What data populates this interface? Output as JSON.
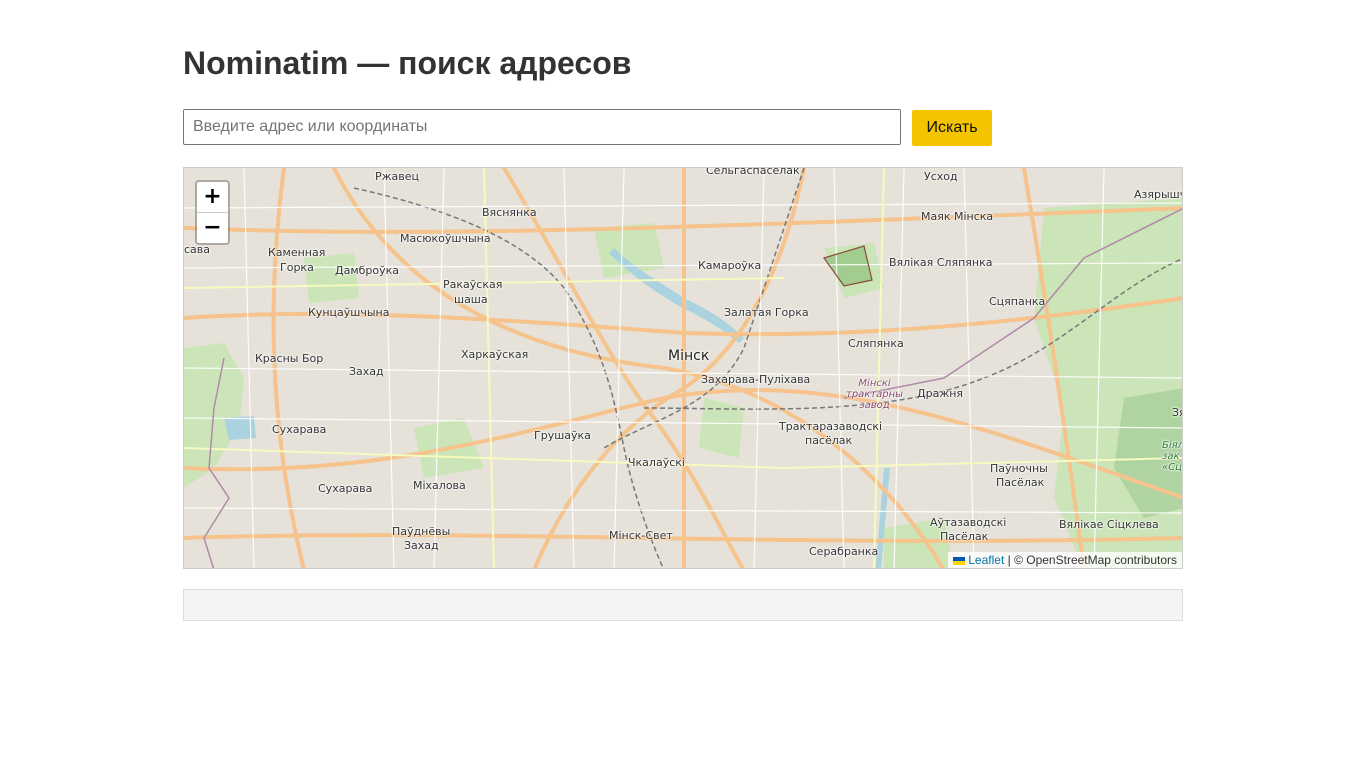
{
  "page": {
    "title": "Nominatim — поиск адресов"
  },
  "search": {
    "placeholder": "Введите адрес или координаты",
    "value": "",
    "button_label": "Искать",
    "button_color": "#f5c400"
  },
  "map": {
    "zoom_in_label": "+",
    "zoom_out_label": "−",
    "attribution": {
      "leaflet_label": "Leaflet",
      "separator": " | © ",
      "osm_label": "OpenStreetMap contributors"
    },
    "labels": {
      "minsk": "Мінск",
      "rzhavets": "Ржавец",
      "vyasnyanka": "Вяснянка",
      "selhaspaselak": "Сельгаспаселак",
      "uskhod": "Усход",
      "azyaryshcha": "Азярышча",
      "mayak": "Маяк Мінска",
      "masyukoushchyna": "Масюкоўшчына",
      "kamennaya_horka_1": "Каменная",
      "kamennaya_horka_2": "Горка",
      "dambrouka": "Дамброўка",
      "rakauskaya_1": "Ракаўская",
      "rakauskaya_2": "шаша",
      "kamarouka": "Камароўка",
      "vyalikaya_slyapyanka": "Вялікая Сляпянка",
      "sasa": "сава",
      "kuntsaushchyna": "Кунцаўшчына",
      "zalataya_horka": "Залатая Горка",
      "slyapyanka": "Сляпянка",
      "krasny_bor": "Красны Бор",
      "kharkauskaya": "Харкаўская",
      "zakhad": "Захад",
      "zakharava": "Захарава-Пуліхава",
      "draznya": "Дражня",
      "tractor_1": "Мінскі",
      "tractor_2": "трактарны",
      "tractor_3": "завод",
      "sukharava_1": "Сухарава",
      "grushauka": "Грушаўка",
      "traktarazavodski_1": "Трактаразаводскі",
      "traktarazavodski_2": "пасёлак",
      "sukharava_2": "Сухарава",
      "mikhalova": "Міхалова",
      "chkalauski": "Чкалаўскі",
      "paunochny_1": "Паўночны",
      "paunochny_2": "Пасёлак",
      "paudnyovy_1": "Паўднёвы",
      "paudnyovy_2": "Захад",
      "autazavodski_1": "Аўтазаводскі",
      "autazavodski_2": "Пасёлак",
      "vyalikaya_sitskleva": "Вялікае Сіцклева",
      "minsk_svet": "Мінск-Свет",
      "serabranka": "Серабранка",
      "sciapanka": "Сцяпанка",
      "zya": "Зя",
      "bial_1": "Біял",
      "bial_2": "зак",
      "bial_3": "«Сці"
    }
  },
  "results": {
    "text": ""
  }
}
